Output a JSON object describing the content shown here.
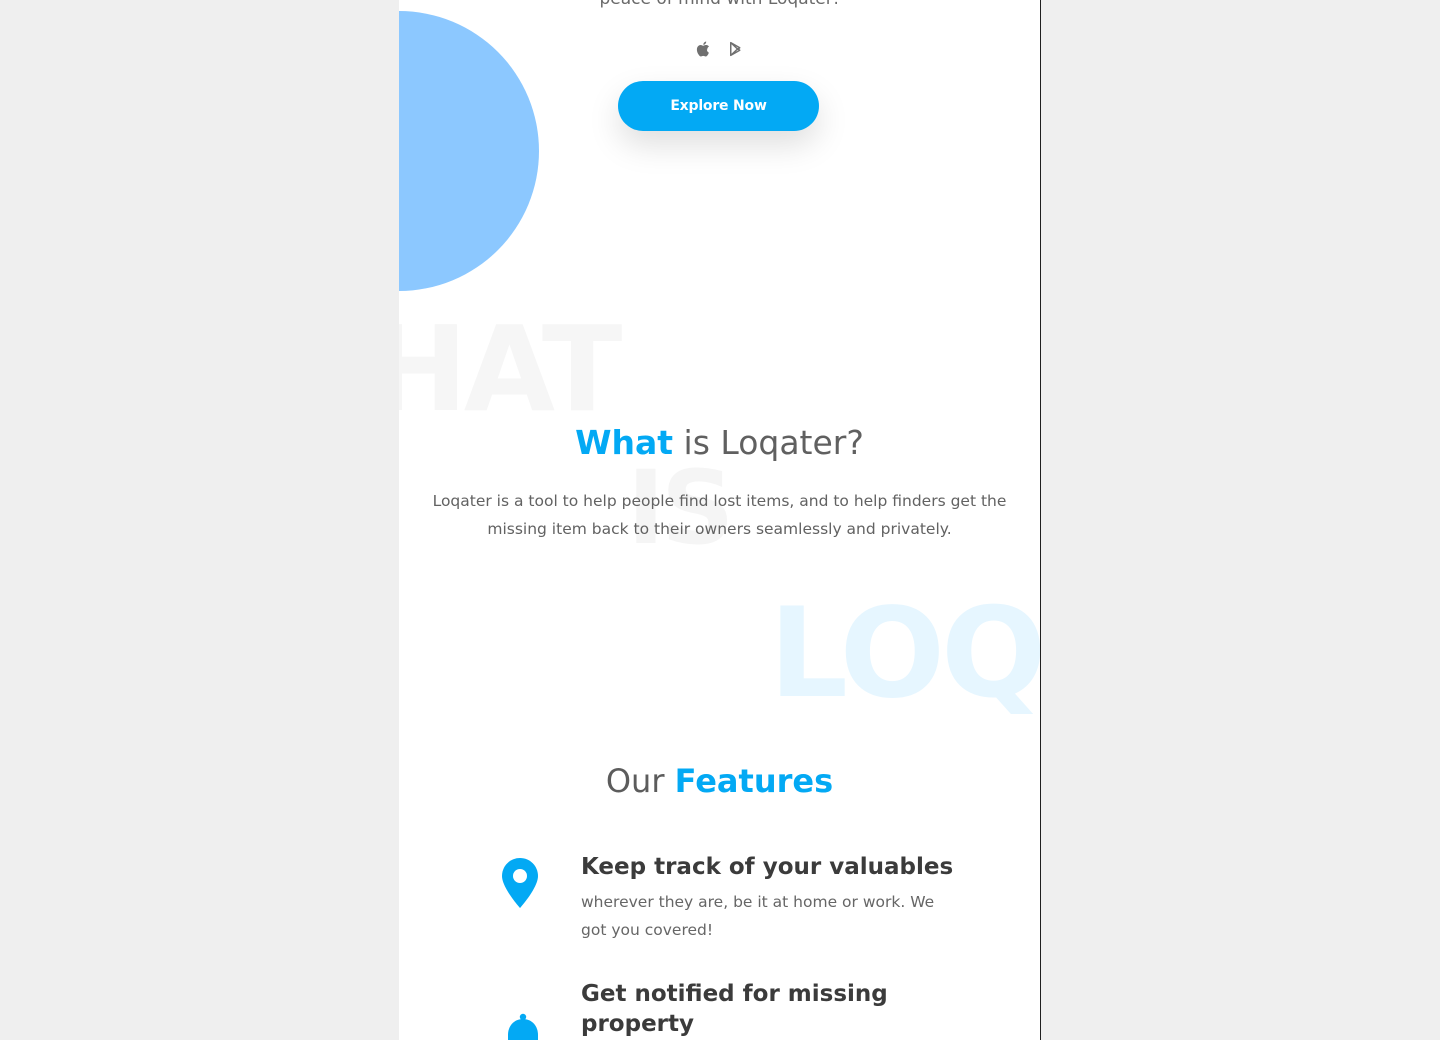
{
  "colors": {
    "accent": "#03a9f4",
    "circle": "#8cc8ff"
  },
  "hero": {
    "tagline": "peace of mind with Loqater!",
    "store_icons": [
      "apple-icon",
      "google-play-icon"
    ],
    "explore_button": "Explore Now"
  },
  "watermarks": {
    "what": "HAT",
    "is": "IS",
    "loq": "LOQ"
  },
  "what_is": {
    "heading_highlight": "What",
    "heading_rest": " is Loqater?",
    "body": "Loqater is a tool to help people find lost items, and to help finders get the missing item back to their owners seamlessly and privately."
  },
  "features": {
    "heading_prefix": "Our ",
    "heading_highlight": "Features",
    "items": [
      {
        "icon": "map-pin-icon",
        "title": "Keep track of your valuables",
        "description": "wherever they are, be it at home or work. We got you covered!"
      },
      {
        "icon": "bell-icon",
        "title": "Get notified for missing property",
        "description": ""
      }
    ]
  }
}
